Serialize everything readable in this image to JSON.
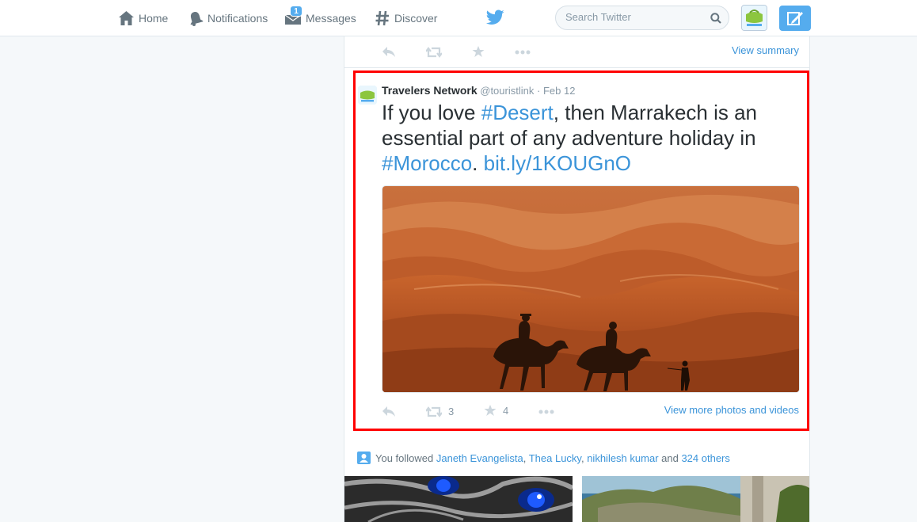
{
  "nav": {
    "home": "Home",
    "notifications": "Notifications",
    "messages": "Messages",
    "messages_badge": "1",
    "discover": "Discover",
    "search_placeholder": "Search Twitter"
  },
  "colors": {
    "brand": "#55acee",
    "link": "#3b94d9",
    "highlight_border": "#ff0000"
  },
  "previous_tweet": {
    "view_link": "View summary"
  },
  "tweet": {
    "name": "Travelers Network",
    "handle": "@touristlink",
    "separator": "·",
    "date": "Feb 12",
    "text_1": "If you love ",
    "hashtag_1": "#Desert",
    "text_2": ", then Marrakech is an essential part of any adventure holiday in ",
    "hashtag_2": "#Morocco",
    "text_3": ". ",
    "url": "bit.ly/1KOUGnO",
    "retweets": "3",
    "favorites": "4",
    "view_link": "View more photos and videos"
  },
  "followed": {
    "prefix": "You followed ",
    "user_1": "Janeth Evangelista",
    "sep_1": ", ",
    "user_2": "Thea Lucky",
    "sep_2": ", ",
    "user_3": "nikhilesh kumar",
    "and": " and ",
    "others": "324 others"
  }
}
